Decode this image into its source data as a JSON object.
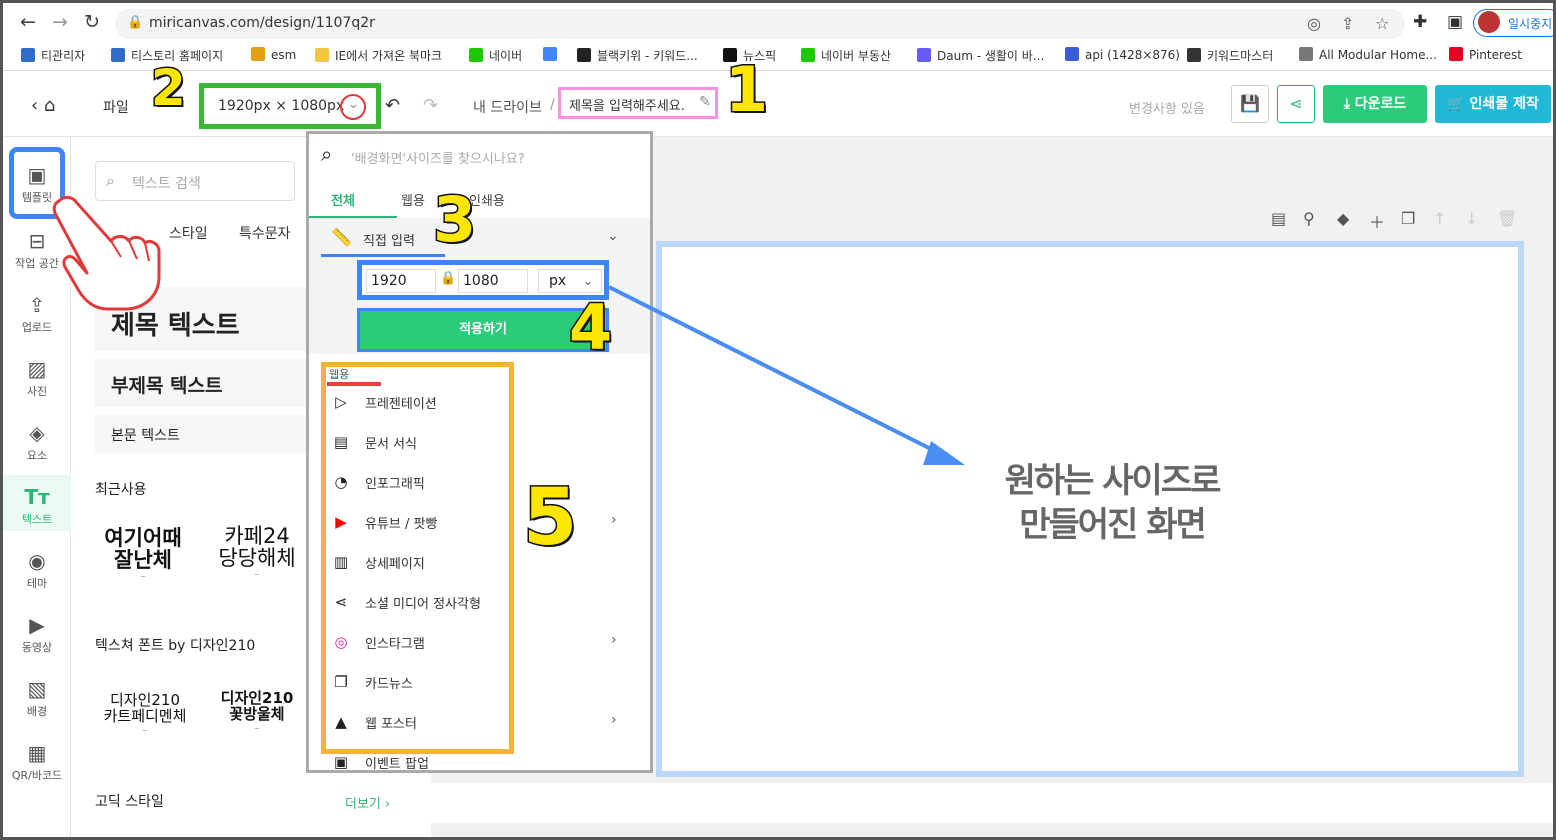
{
  "browser": {
    "url": "miricanvas.com/design/1107q2r",
    "pause_label": "일시중지"
  },
  "bookmarks": [
    {
      "label": "티관리자",
      "color": "#2f6cc9"
    },
    {
      "label": "티스토리 홈페이지",
      "color": "#2f6cc9"
    },
    {
      "label": "esm",
      "color": "#e2a012"
    },
    {
      "label": "IE에서 가져온 북마크",
      "color": "#f4c542"
    },
    {
      "label": "네이버",
      "color": "#1ec800"
    },
    {
      "label": "",
      "color": "#4285f4"
    },
    {
      "label": "블랙키위 - 키워드...",
      "color": "#222222"
    },
    {
      "label": "뉴스픽",
      "color": "#111111"
    },
    {
      "label": "네이버 부동산",
      "color": "#1ec800"
    },
    {
      "label": "Daum - 생활이 바...",
      "color": "#6a5af9"
    },
    {
      "label": "api (1428×876)",
      "color": "#3b5bdb"
    },
    {
      "label": "키워드마스터",
      "color": "#333333"
    },
    {
      "label": "All Modular Home...",
      "color": "#777777"
    },
    {
      "label": "Pinterest",
      "color": "#e60023"
    }
  ],
  "header": {
    "file_menu": "파일",
    "size_label": "1920px × 1080px",
    "breadcrumb_drive": "내 드라이브",
    "breadcrumb_sep": "/",
    "doc_title": "제목을 입력해주세요.",
    "changes_status": "변경사항 있음",
    "download_label": "다운로드",
    "print_label": "인쇄물 제작"
  },
  "rail": [
    {
      "label": "템플릿",
      "icon": "▣"
    },
    {
      "label": "작업 공간",
      "icon": "⊟"
    },
    {
      "label": "업로드",
      "icon": "⇪"
    },
    {
      "label": "사진",
      "icon": "▨"
    },
    {
      "label": "요소",
      "icon": "◈"
    },
    {
      "label": "텍스트",
      "icon": "Tт"
    },
    {
      "label": "테마",
      "icon": "◉"
    },
    {
      "label": "동영상",
      "icon": "▶"
    },
    {
      "label": "배경",
      "icon": "▧"
    },
    {
      "label": "QR/바코드",
      "icon": "▦"
    }
  ],
  "panel": {
    "search_placeholder": "텍스트 검색",
    "tabs": [
      "스타일",
      "특수문자"
    ],
    "title_text": "제목 텍스트",
    "subtitle_text": "부제목 텍스트",
    "body_text": "본문 텍스트",
    "recent_title": "최근사용",
    "recent_fonts": [
      {
        "name": "여기어때 잘난체",
        "line1": "여기어때",
        "line2": "잘난체"
      },
      {
        "name": "카페24 당당해체",
        "line1": "카페24",
        "line2": "당당해체"
      }
    ],
    "texture_title": "텍스쳐 폰트 by 디자인210",
    "texture_fonts": [
      {
        "line1": "디자인210",
        "line2": "카트페디멘체"
      },
      {
        "line1": "디자인210",
        "line2": "꽃방울체"
      }
    ],
    "gothic_title": "고딕 스타일",
    "more_label": "더보기 ›"
  },
  "dropdown": {
    "search_placeholder": "'배경화면'사이즈를 찾으시나요?",
    "tabs": [
      "전체",
      "웹용",
      "인쇄용"
    ],
    "direct_input_label": "직접 입력",
    "width_value": "1920",
    "height_value": "1080",
    "unit_value": "px",
    "apply_label": "적용하기",
    "list_header": "웹용",
    "items": [
      {
        "label": "프레젠테이션",
        "icon": "▷",
        "chevron": false
      },
      {
        "label": "문서 서식",
        "icon": "▤",
        "chevron": false
      },
      {
        "label": "인포그래픽",
        "icon": "◔",
        "chevron": false
      },
      {
        "label": "유튜브 / 팟빵",
        "icon": "▶",
        "chevron": true
      },
      {
        "label": "상세페이지",
        "icon": "▥",
        "chevron": false
      },
      {
        "label": "소셜 미디어 정사각형",
        "icon": "⋖",
        "chevron": false
      },
      {
        "label": "인스타그램",
        "icon": "◎",
        "chevron": true
      },
      {
        "label": "카드뉴스",
        "icon": "❐",
        "chevron": false
      },
      {
        "label": "웹 포스터",
        "icon": "▲",
        "chevron": true
      },
      {
        "label": "이벤트 팝업",
        "icon": "▣",
        "chevron": false
      }
    ]
  },
  "canvas": {
    "message_line1": "원하는 사이즈로",
    "message_line2": "만들어진 화면"
  },
  "annotations": [
    "1",
    "2",
    "3",
    "4",
    "5"
  ]
}
